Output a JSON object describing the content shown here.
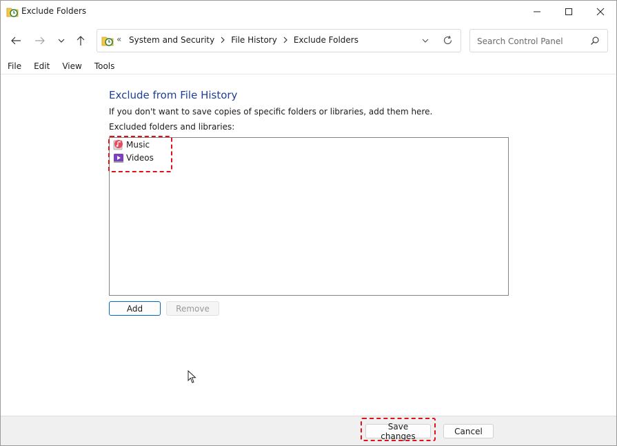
{
  "window": {
    "title": "Exclude Folders",
    "icon": "file-history-icon"
  },
  "address_bar": {
    "overflow_label": "«",
    "crumbs": [
      "System and Security",
      "File History",
      "Exclude Folders"
    ]
  },
  "search": {
    "placeholder": "Search Control Panel"
  },
  "menu": {
    "items": [
      "File",
      "Edit",
      "View",
      "Tools"
    ]
  },
  "main": {
    "heading": "Exclude from File History",
    "description": "If you don't want to save copies of specific folders or libraries, add them here.",
    "list_label": "Excluded folders and libraries:",
    "excluded_items": [
      {
        "label": "Music",
        "icon": "music-library-icon"
      },
      {
        "label": "Videos",
        "icon": "videos-library-icon"
      }
    ],
    "add_label": "Add",
    "remove_label": "Remove"
  },
  "footer": {
    "save_label": "Save changes",
    "cancel_label": "Cancel"
  },
  "colors": {
    "heading": "#1c3f94",
    "highlight": "#e0101a",
    "primary_border": "#0067c0"
  }
}
